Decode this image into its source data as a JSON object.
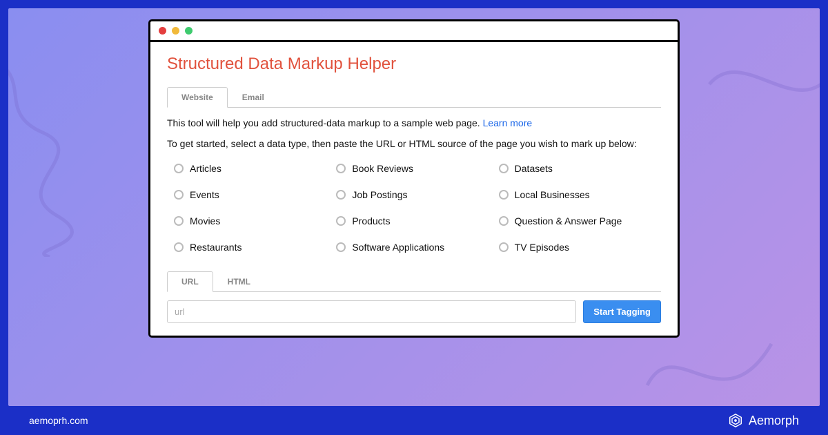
{
  "header": {
    "title": "Structured Data Markup Helper"
  },
  "source_tabs": {
    "items": [
      {
        "label": "Website",
        "active": true
      },
      {
        "label": "Email",
        "active": false
      }
    ]
  },
  "description": {
    "text": "This tool will help you add structured-data markup to a sample web page. ",
    "learn_more": "Learn more"
  },
  "instruction": "To get started, select a data type, then paste the URL or HTML source of the page you wish to mark up below:",
  "data_types": [
    "Articles",
    "Book Reviews",
    "Datasets",
    "Events",
    "Job Postings",
    "Local Businesses",
    "Movies",
    "Products",
    "Question & Answer Page",
    "Restaurants",
    "Software Applications",
    "TV Episodes"
  ],
  "input_tabs": {
    "items": [
      {
        "label": "URL",
        "active": true
      },
      {
        "label": "HTML",
        "active": false
      }
    ]
  },
  "url_input": {
    "placeholder": "url",
    "value": ""
  },
  "buttons": {
    "start_tagging": "Start Tagging"
  },
  "footer": {
    "domain": "aemoprh.com",
    "brand": "Aemorph"
  }
}
